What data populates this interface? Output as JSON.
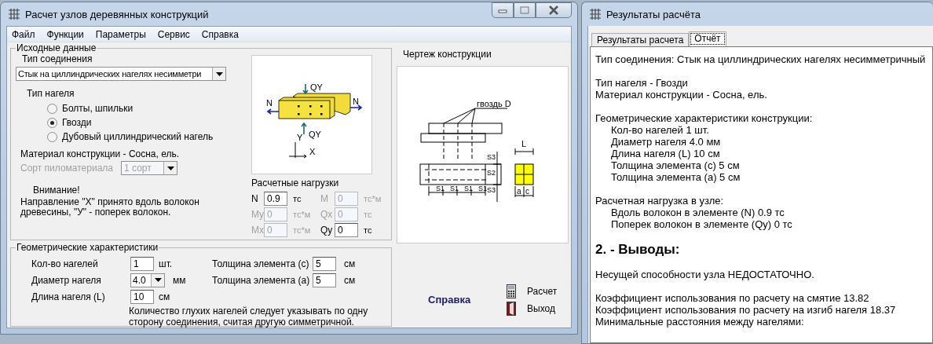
{
  "main_window": {
    "title": "Расчет узлов деревянных конструкций",
    "menu": [
      "Файл",
      "Функции",
      "Параметры",
      "Сервис",
      "Справка"
    ],
    "source_group": {
      "title": "Исходные данные",
      "connection_label": "Тип соединения",
      "connection_value": "Стык на циллиндрических нагелях несимметри",
      "dowel_label": "Тип нагеля",
      "dowel_options": [
        {
          "label": "Болты, шпильки",
          "selected": false
        },
        {
          "label": "Гвозди",
          "selected": true
        },
        {
          "label": "Дубовый циллиндрический нагель",
          "selected": false
        }
      ],
      "material": "Материал конструкции - Сосна, ель.",
      "grade_label": "Сорт пиломатериала",
      "grade_value": "1 сорт",
      "grade_disabled": true,
      "warning_title": "Внимание!",
      "warning_text": "Направление \"X\" принято вдоль волокон древесины, \"У\" - поперек волокон.",
      "diagram_labels": [
        "N",
        "N",
        "QY",
        "QY",
        "Y",
        "X"
      ],
      "loads": {
        "title": "Расчетные нагрузки",
        "fields": [
          {
            "label": "N",
            "value": "0.9",
            "unit": "тс",
            "disabled": false
          },
          {
            "label": "M",
            "value": "0",
            "unit": "тс*м",
            "disabled": true
          },
          {
            "label": "My",
            "value": "0",
            "unit": "тс*м",
            "disabled": true
          },
          {
            "label": "Qx",
            "value": "0",
            "unit": "тс",
            "disabled": true
          },
          {
            "label": "Mx",
            "value": "0",
            "unit": "тс*м",
            "disabled": true
          },
          {
            "label": "Qy",
            "value": "0",
            "unit": "тс",
            "disabled": false
          }
        ]
      }
    },
    "geometry_group": {
      "title": "Геометрические характеристики",
      "fields": [
        {
          "label": "Кол-во нагелей",
          "value": "1",
          "unit": "шт.",
          "kind": "input"
        },
        {
          "label": "Диаметр нагеля",
          "value": "4.0",
          "unit": "мм",
          "kind": "select"
        },
        {
          "label": "Длина нагеля (L)",
          "value": "10",
          "unit": "см",
          "kind": "input"
        }
      ],
      "thickness": [
        {
          "label": "Толщина элемента (с)",
          "value": "5",
          "unit": "см"
        },
        {
          "label": "Толщина элемента (а)",
          "value": "5",
          "unit": "см"
        }
      ],
      "note": "Количество глухих нагелей следует указывать по одну сторону соединения, считая другую симметричной."
    },
    "drawing": {
      "title": "Чертеж конструкции",
      "nail_label": "гвоздь D",
      "spacing_labels": [
        "S1",
        "S1",
        "S1",
        "S1"
      ],
      "edge_labels": [
        "S3",
        "S2",
        "S3"
      ],
      "length_label": "L",
      "thickness_labels": [
        "a",
        "c"
      ]
    },
    "help_link": "Справка",
    "buttons": [
      {
        "kind": "calculate",
        "label": "Расчет"
      },
      {
        "kind": "exit",
        "label": "Выход"
      }
    ]
  },
  "results_window": {
    "title": "Результаты расчёта",
    "tabs": [
      {
        "label": "Результаты расчета",
        "selected": false
      },
      {
        "label": "Отчёт",
        "selected": true
      }
    ],
    "report": [
      {
        "kind": "paragraph",
        "lines": [
          "Тип соединения:  Стык на циллиндрических нагелях несимметричный"
        ]
      },
      {
        "kind": "paragraph",
        "lines": [
          "Тип нагеля  -   Гвозди",
          "Материал конструкции  -  Сосна, ель."
        ]
      },
      {
        "kind": "section",
        "title": "Геометрические характеристики конструкции:",
        "items": [
          "Кол-во нагелей  1 шт.",
          "Диаметр нагеля  4.0 мм",
          "Длина нагеля (L)  10 см",
          "Толщина элемента (с)  5 см",
          "Толщина элемента (а)  5 см"
        ]
      },
      {
        "kind": "section",
        "title": "Расчетная нагрузка в узле:",
        "items": [
          "Вдоль волокон в элементе (N)  0.9 тс",
          "Поперек волокон в элементе (Qy)  0 тс"
        ]
      },
      {
        "kind": "heading",
        "text": "2. - Выводы:"
      },
      {
        "kind": "paragraph",
        "lines": [
          "Несущей способности узла НЕДОСТАТОЧНО."
        ]
      },
      {
        "kind": "paragraph",
        "lines": [
          "Коэффициент использования по расчету на смятие  13.82",
          "Коэффициент использования по расчету на изгиб нагеля   18.37",
          "Минимальные расстояния между нагелями:"
        ]
      }
    ]
  }
}
